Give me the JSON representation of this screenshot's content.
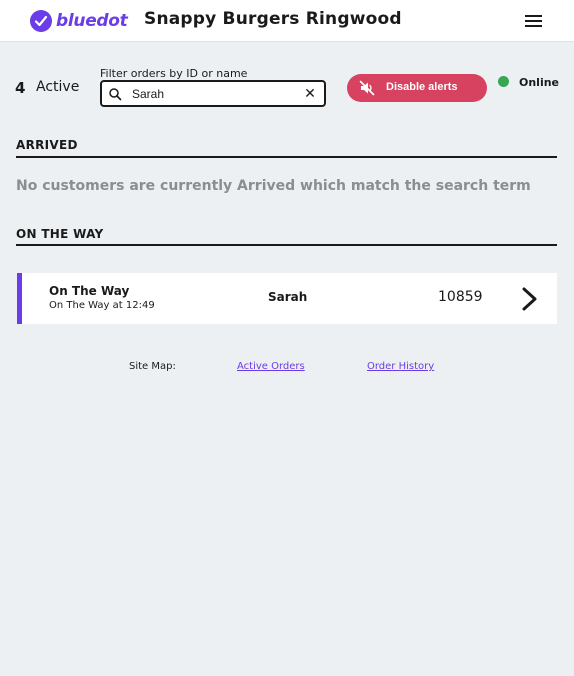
{
  "header": {
    "logo_text": "bluedot",
    "store_name": "Snappy Burgers Ringwood",
    "menu_icon": "hamburger-menu-icon"
  },
  "toolbar": {
    "active_count": "4",
    "active_label": "Active",
    "filter_label": "Filter orders by ID or name",
    "search_value": "Sarah",
    "clear_symbol": "✕",
    "alerts_label": "Disable alerts",
    "status_text": "Online"
  },
  "sections": {
    "arrived": {
      "heading": "ARRIVED",
      "empty_message": "No customers are currently Arrived which match the search term"
    },
    "on_the_way": {
      "heading": "ON THE WAY",
      "orders": [
        {
          "status": "On The Way",
          "time_text": "On The Way at 12:49",
          "customer": "Sarah",
          "order_id": "10859"
        }
      ]
    }
  },
  "footer": {
    "sitemap_label": "Site Map:",
    "links": [
      "Active Orders",
      "Order History"
    ]
  },
  "colors": {
    "brand": "#6a3de8",
    "alert": "#d6425f",
    "online": "#35a854",
    "muted_text": "#8a8d91",
    "background": "#edf0f3"
  }
}
